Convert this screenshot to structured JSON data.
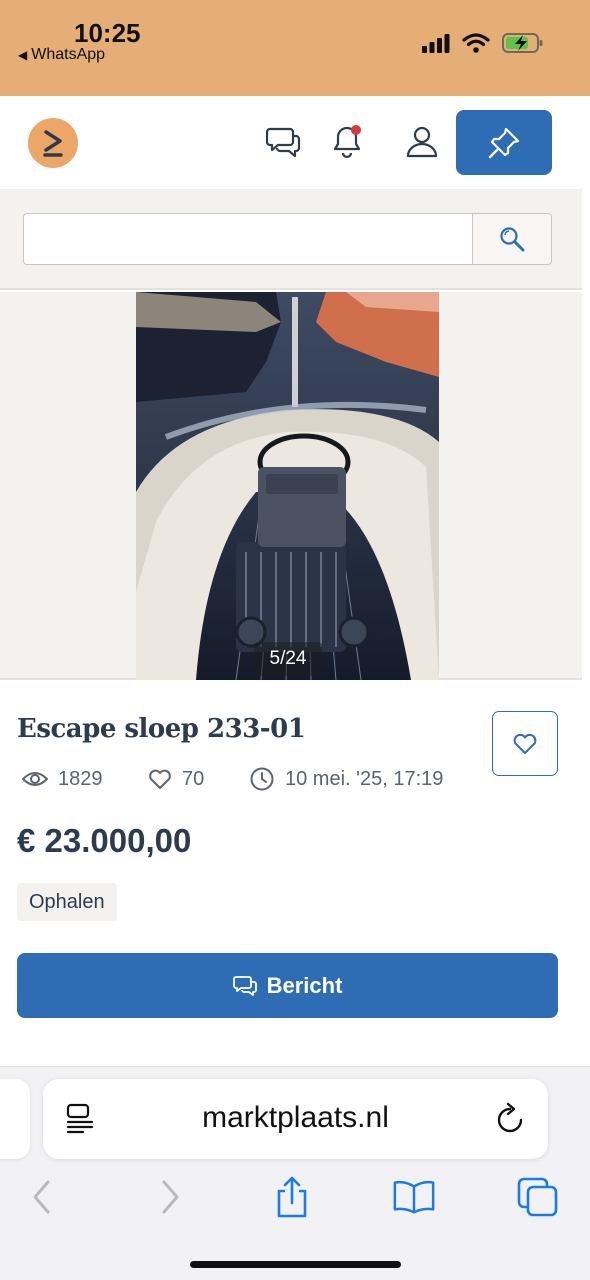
{
  "status_bar": {
    "time": "10:25",
    "back_app": "WhatsApp",
    "icons": [
      "signal-icon",
      "wifi-icon",
      "battery-charging-icon"
    ]
  },
  "header": {
    "logo": "marktplaats-logo",
    "icons": [
      "chat-icon",
      "bell-icon",
      "user-icon",
      "pin-icon"
    ],
    "notification_dot_color": "#d23c3c",
    "accent_color": "#2e6db4"
  },
  "search": {
    "value": "",
    "icon": "search-icon"
  },
  "gallery": {
    "counter": "5/24"
  },
  "listing": {
    "title": "Escape sloep 233-01",
    "views": "1829",
    "favorites": "70",
    "date": "10 mei. '25, 17:19",
    "price": "€ 23.000,00",
    "delivery_tag": "Ophalen",
    "message_button": "Bericht"
  },
  "browser": {
    "url": "marktplaats.nl",
    "toolbar_icons": [
      "back-icon",
      "forward-icon",
      "share-icon",
      "bookmarks-icon",
      "tabs-icon"
    ]
  }
}
